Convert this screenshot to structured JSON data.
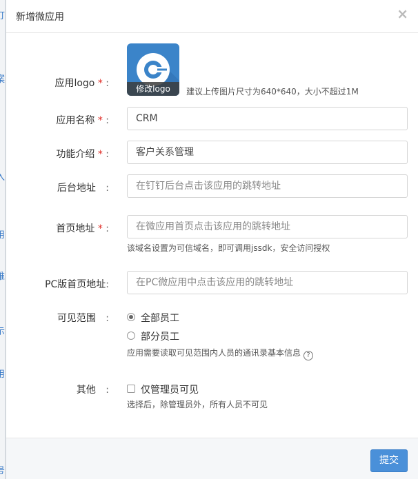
{
  "background": {
    "fragments": [
      "订",
      "案",
      "入",
      "用",
      "维",
      "示",
      "用",
      "号"
    ]
  },
  "modal": {
    "title": "新增微应用",
    "close_glyph": "×"
  },
  "form": {
    "logo": {
      "label": "应用logo",
      "edit_label": "修改logo",
      "hint": "建议上传图片尺寸为640*640，大小不超过1M"
    },
    "name": {
      "label": "应用名称",
      "value": "CRM"
    },
    "description": {
      "label": "功能介绍",
      "value": "客户关系管理"
    },
    "admin_url": {
      "label": "后台地址",
      "placeholder": "在钉钉后台点击该应用的跳转地址"
    },
    "home_url": {
      "label": "首页地址",
      "placeholder": "在微应用首页点击该应用的跳转地址",
      "hint": "该域名设置为可信域名，即可调用jssdk，安全访问授权"
    },
    "pc_home_url": {
      "label": "PC版首页地址",
      "placeholder": "在PC微应用中点击该应用的跳转地址"
    },
    "visibility": {
      "label": "可见范围",
      "options": [
        "全部员工",
        "部分员工"
      ],
      "selected": "全部员工",
      "hint": "应用需要读取可见范围内人员的通讯录基本信息"
    },
    "other": {
      "label": "其他",
      "checkbox_label": "仅管理员可见",
      "hint": "选择后，除管理员外，所有人员不可见"
    },
    "required_mark": "*",
    "colon": ":",
    "help_glyph": "?"
  },
  "footer": {
    "submit_label": "提交"
  },
  "colors": {
    "accent": "#4a90d9",
    "required": "#e0302a",
    "logo_bg": "#3b84c9"
  }
}
